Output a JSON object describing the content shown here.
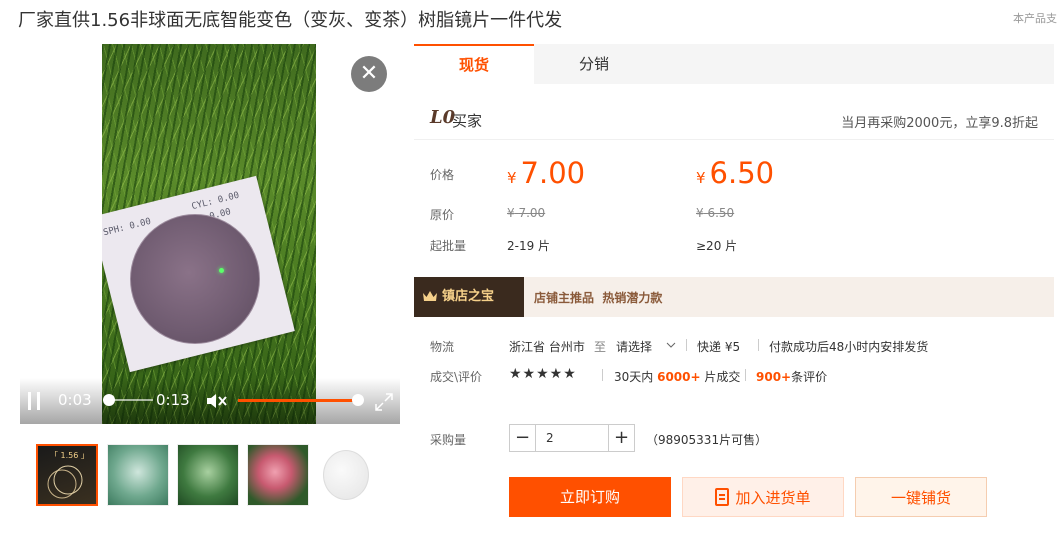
{
  "page": {
    "title": "厂家直供1.56非球面无底智能变色（变灰、变茶）树脂镜片一件代发",
    "top_right_text": "本产品支"
  },
  "video": {
    "card_text_sph": "SPH: 0.00",
    "card_text_cyl": "CYL: 0.00",
    "card_text_extra": "0.00",
    "current_time": "0:03",
    "duration": "0:13",
    "progress": 0.23,
    "volume": 1.0
  },
  "thumbnails": [
    {
      "name": "thumb-1",
      "label": "「 1.56 」",
      "selected": true
    },
    {
      "name": "thumb-2",
      "selected": false
    },
    {
      "name": "thumb-3",
      "selected": false
    },
    {
      "name": "thumb-4",
      "selected": false
    },
    {
      "name": "thumb-5",
      "selected": false
    }
  ],
  "tabs": [
    {
      "label": "现货",
      "active": true
    },
    {
      "label": "分销",
      "active": false
    }
  ],
  "buyer": {
    "logo": "L0",
    "logo_text": "买家",
    "promo": "当月再采购2000元，立享9.8折起"
  },
  "pricing": {
    "price_label": "价格",
    "original_label": "原价",
    "moq_label": "起批量",
    "currency": "¥",
    "tiers": [
      {
        "price": "7.00",
        "original": "7.00",
        "moq": "2-19 片"
      },
      {
        "price": "6.50",
        "original": "6.50",
        "moq": "≥20 片"
      }
    ]
  },
  "banner": {
    "title": "镇店之宝",
    "tags": "店铺主推品  热销潜力款"
  },
  "logistics": {
    "label": "物流",
    "origin": "浙江省 台州市",
    "to": "至",
    "destination": "请选择",
    "shipping": "快递 ¥5",
    "promise": "付款成功后48小时内安排发货"
  },
  "deals": {
    "label": "成交\\评价",
    "stars": "★★★★★",
    "period": "30天内",
    "sold_count": "6000+",
    "sold_unit": "片成交",
    "review_count": "900+",
    "review_unit": "条评价"
  },
  "quantity": {
    "label": "采购量",
    "minus": "−",
    "plus": "+",
    "value": "2",
    "stock": "（98905331片可售）"
  },
  "actions": {
    "buy": "立即订购",
    "cart": "加入进货单",
    "ship": "一键铺货"
  },
  "colors": {
    "accent": "#ff5000",
    "banner_dark": "#3a2a1e",
    "banner_light": "#f6efe9"
  }
}
